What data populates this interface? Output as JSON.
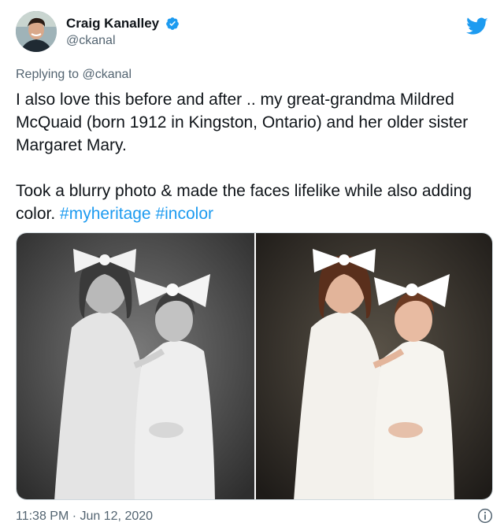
{
  "tweet": {
    "author": {
      "display_name": "Craig Kanalley",
      "handle": "@ckanal",
      "verified": true,
      "avatar_icon": "user-avatar"
    },
    "brand_icon": "twitter-bird-icon",
    "reply": {
      "prefix": "Replying to",
      "mention": "@ckanal"
    },
    "paragraph_1": "I also love this before and after ..  my great-grandma Mildred McQuaid (born 1912 in Kingston, Ontario) and her older sister Margaret Mary.",
    "paragraph_2_text": "Took a blurry photo & made the faces lifelike while also adding color.",
    "hashtags": [
      "#myheritage",
      "#incolor"
    ],
    "media": [
      {
        "label": "before-photo-black-and-white"
      },
      {
        "label": "after-photo-colorized"
      }
    ],
    "timestamp": "11:38 PM · Jun 12, 2020",
    "info_icon": "info-icon"
  },
  "colors": {
    "link": "#1d9bf0",
    "secondary_text": "#536471",
    "primary_text": "#0f1419"
  }
}
